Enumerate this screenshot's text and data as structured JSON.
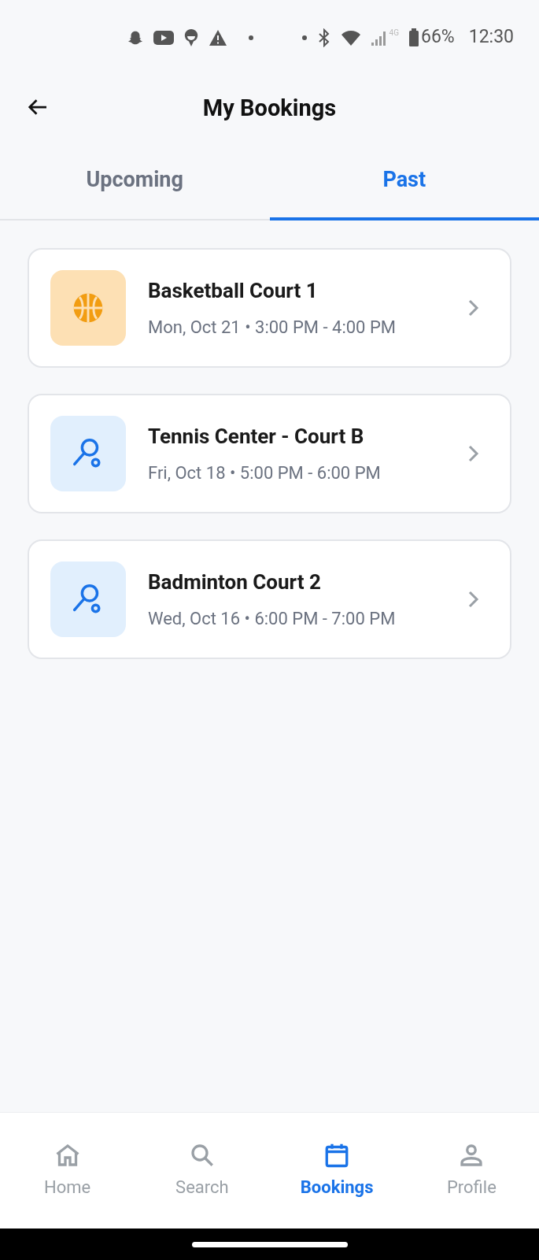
{
  "status_bar": {
    "network": "4G",
    "battery": "66%",
    "time": "12:30"
  },
  "header": {
    "title": "My Bookings"
  },
  "tabs": [
    {
      "label": "Upcoming",
      "selected": false
    },
    {
      "label": "Past",
      "selected": true
    }
  ],
  "bookings": [
    {
      "kind": "basketball",
      "title": "Basketball Court 1",
      "when": "Mon, Oct 21 • 3:00 PM - 4:00 PM"
    },
    {
      "kind": "racket",
      "title": "Tennis Center - Court B",
      "when": "Fri, Oct 18 • 5:00 PM - 6:00 PM"
    },
    {
      "kind": "racket",
      "title": "Badminton Court 2",
      "when": "Wed, Oct 16 • 6:00 PM - 7:00 PM"
    }
  ],
  "bottom_nav": [
    {
      "kind": "home",
      "label": "Home",
      "selected": false
    },
    {
      "kind": "search",
      "label": "Search",
      "selected": false
    },
    {
      "kind": "calendar",
      "label": "Bookings",
      "selected": true
    },
    {
      "kind": "person",
      "label": "Profile",
      "selected": false
    }
  ]
}
